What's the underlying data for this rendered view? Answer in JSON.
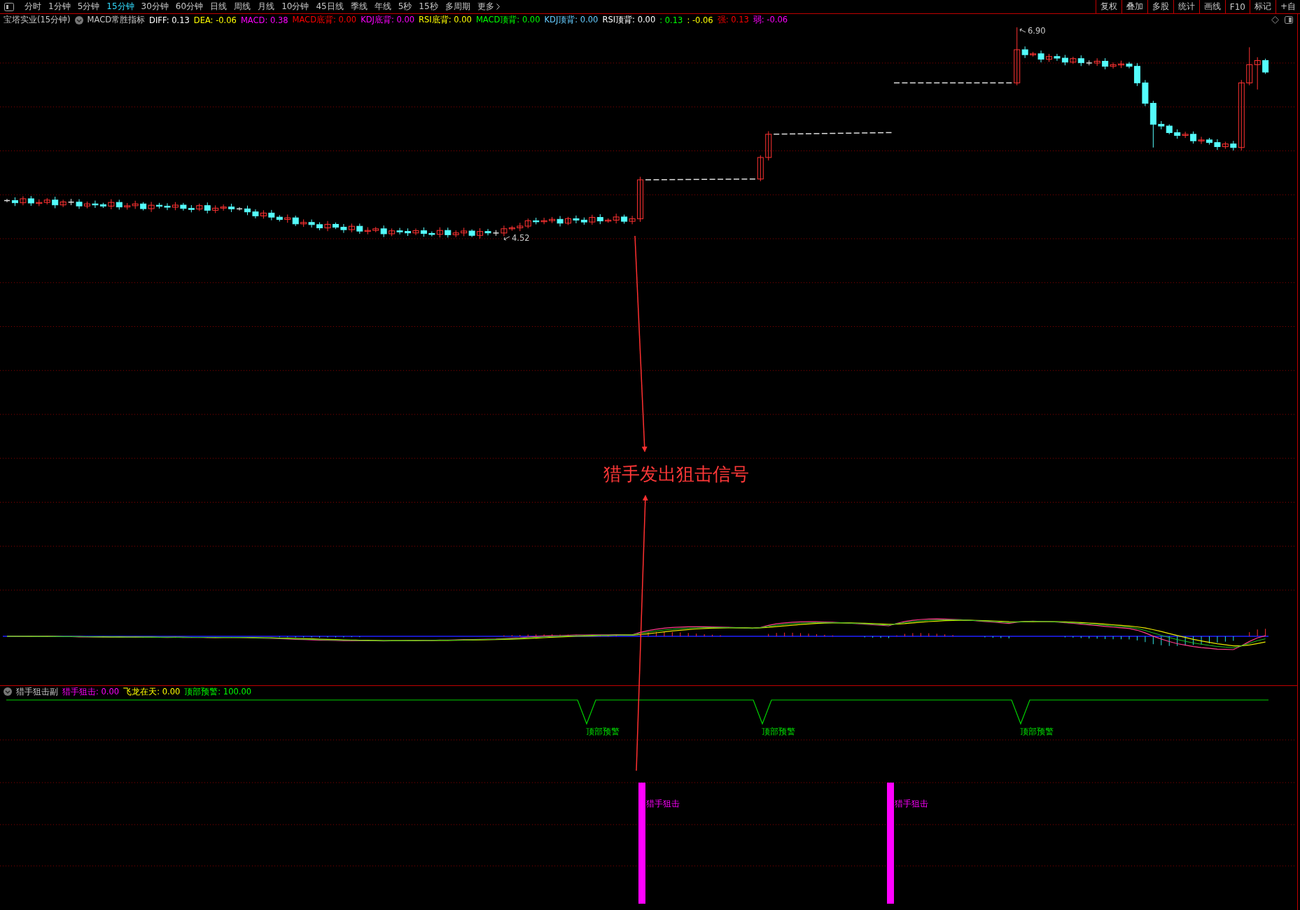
{
  "toolbar": {
    "periods": [
      {
        "label": "分时",
        "selected": false
      },
      {
        "label": "1分钟",
        "selected": false
      },
      {
        "label": "5分钟",
        "selected": false
      },
      {
        "label": "15分钟",
        "selected": true
      },
      {
        "label": "30分钟",
        "selected": false
      },
      {
        "label": "60分钟",
        "selected": false
      },
      {
        "label": "日线",
        "selected": false
      },
      {
        "label": "周线",
        "selected": false
      },
      {
        "label": "月线",
        "selected": false
      },
      {
        "label": "10分钟",
        "selected": false
      },
      {
        "label": "45日线",
        "selected": false
      },
      {
        "label": "季线",
        "selected": false
      },
      {
        "label": "年线",
        "selected": false
      },
      {
        "label": "5秒",
        "selected": false
      },
      {
        "label": "15秒",
        "selected": false
      },
      {
        "label": "多周期",
        "selected": false
      }
    ],
    "more": "更多",
    "right_buttons": [
      "复权",
      "叠加",
      "多股",
      "统计",
      "画线",
      "F10",
      "标记",
      "+自"
    ]
  },
  "main_chart": {
    "title": "宝塔实业(15分钟)",
    "indicator": "MACD常胜指标",
    "legend": [
      {
        "label": "DIFF: 0.13",
        "color": "#ffffff"
      },
      {
        "label": "DEA: -0.06",
        "color": "#ffff00"
      },
      {
        "label": "MACD: 0.38",
        "color": "#ff00ff"
      },
      {
        "label": "MACD底背: 0.00",
        "color": "#ff0000"
      },
      {
        "label": "KDJ底背: 0.00",
        "color": "#ff00ff"
      },
      {
        "label": "RSI底背: 0.00",
        "color": "#ffff00"
      },
      {
        "label": "MACD顶背: 0.00",
        "color": "#00ff00"
      },
      {
        "label": "KDJ顶背: 0.00",
        "color": "#66ccff"
      },
      {
        "label": "RSI顶背: 0.00",
        "color": "#ffffff"
      },
      {
        "label": ": 0.13",
        "color": "#00ff00"
      },
      {
        "label": ": -0.06",
        "color": "#ffff00"
      },
      {
        "label": "强: 0.13",
        "color": "#ff0000"
      },
      {
        "label": "弱: -0.06",
        "color": "#ff00ff"
      }
    ],
    "high_label": "6.90",
    "low_label": "4.52",
    "annotation": "猎手发出狙击信号"
  },
  "sub_panel": {
    "title": "猎手狙击副",
    "legend": [
      {
        "label": "猎手狙击: 0.00",
        "color": "#ff00ff"
      },
      {
        "label": "飞龙在天: 0.00",
        "color": "#ffff00"
      },
      {
        "label": "顶部预警: 100.00",
        "color": "#00ff00"
      }
    ],
    "warning_labels": [
      "顶部预警",
      "顶部预警",
      "顶部预警"
    ],
    "signal_labels": [
      "猎手狙击",
      "猎手狙击"
    ]
  }
}
